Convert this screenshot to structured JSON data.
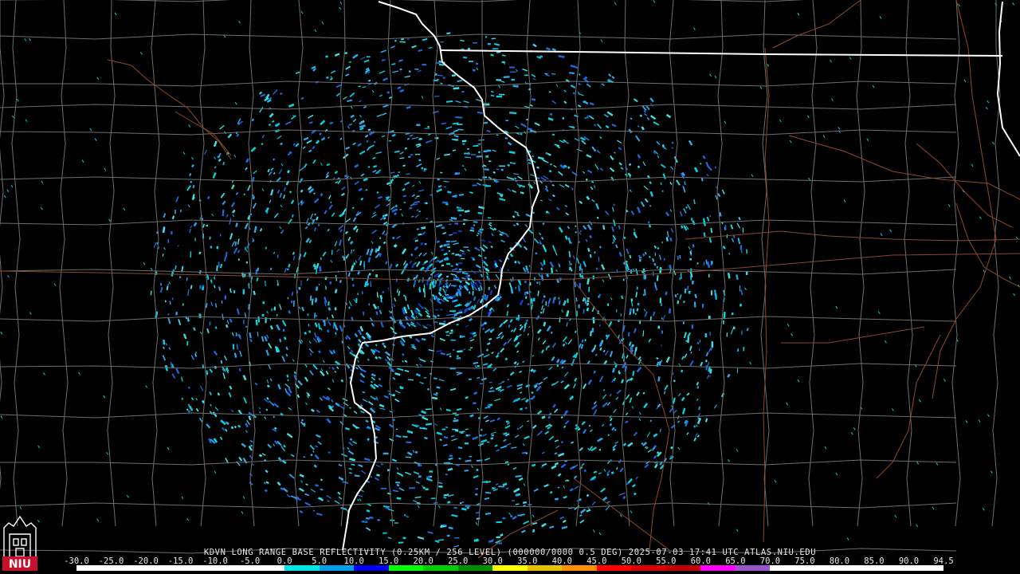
{
  "product_caption": "KDVN LONG RANGE BASE REFLECTIVITY (0.25KM / 256 LEVEL) (000000/0000 0.5 DEG) 2025-07-03 17:41 UTC  ATLAS.NIU.EDU",
  "logo": {
    "text": "NIU",
    "icon": "niu-tower-logo",
    "color": "#c8102e"
  },
  "color_scale": {
    "labels": [
      "-30.0",
      "-25.0",
      "-20.0",
      "-15.0",
      "-10.0",
      "-5.0",
      "0.0",
      "5.0",
      "10.0",
      "15.0",
      "20.0",
      "25.0",
      "30.0",
      "35.0",
      "40.0",
      "45.0",
      "50.0",
      "55.0",
      "60.0",
      "65.0",
      "70.0",
      "75.0",
      "80.0",
      "85.0",
      "90.0",
      "94.5"
    ],
    "colors": [
      "#ffffff",
      "#ffffff",
      "#ffffff",
      "#ffffff",
      "#ffffff",
      "#ffffff",
      "#00e6e6",
      "#009de8",
      "#0000f0",
      "#00ff00",
      "#00cc00",
      "#008e00",
      "#ffff00",
      "#e8c000",
      "#ff9000",
      "#ff0000",
      "#d60000",
      "#c00000",
      "#ff00ff",
      "#9955c9",
      "#ffffff",
      "#ffffff",
      "#ffffff",
      "#ffffff",
      "#ffffff"
    ]
  },
  "map_style": {
    "background": "#000000",
    "county_lines": "#6e6e6e",
    "state_lines": "#ffffff",
    "highways": "#8b4a2b",
    "echo_colors": [
      "#00d5e0",
      "#2aa8e8",
      "#1e6ae0",
      "#37e1e6",
      "#0a3fd0"
    ],
    "radar_site": "#000000"
  }
}
